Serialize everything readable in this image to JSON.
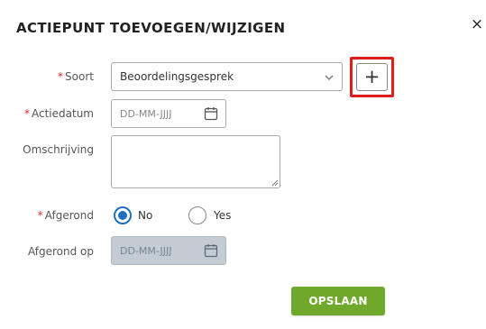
{
  "dialog": {
    "title": "ACTIEPUNT TOEVOEGEN/WIJZIGEN",
    "close_symbol": "×"
  },
  "required_marker": "*",
  "fields": {
    "soort": {
      "label": "Soort",
      "required": true,
      "value": "Beoordelingsgesprek",
      "icon": "chevron-down-icon"
    },
    "add_button": {
      "symbol": "+",
      "highlight_color": "#e31b1b"
    },
    "actiedatum": {
      "label": "Actiedatum",
      "required": true,
      "placeholder": "DD-MM-JJJJ",
      "icon": "calendar-icon"
    },
    "omschrijving": {
      "label": "Omschrijving",
      "required": false,
      "value": ""
    },
    "afgerond": {
      "label": "Afgerond",
      "required": true,
      "options": [
        {
          "label": "No",
          "selected": true
        },
        {
          "label": "Yes",
          "selected": false
        }
      ]
    },
    "afgerond_op": {
      "label": "Afgerond op",
      "placeholder": "DD-MM-JJJJ",
      "disabled": true,
      "icon": "calendar-icon"
    }
  },
  "actions": {
    "save_label": "OPSLAAN"
  },
  "colors": {
    "accent": "#1f6fbf",
    "save": "#6fa82b",
    "required": "#d9262e",
    "disabled_bg": "#c3cbd3"
  }
}
